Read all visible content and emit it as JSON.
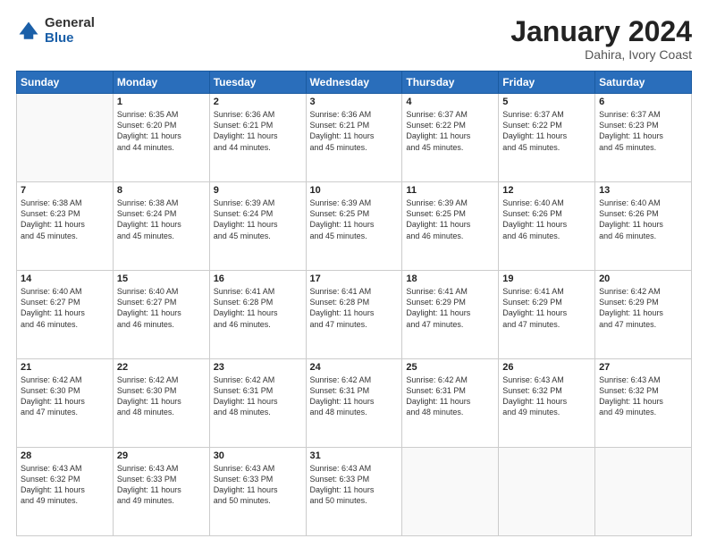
{
  "header": {
    "logo_general": "General",
    "logo_blue": "Blue",
    "month_title": "January 2024",
    "location": "Dahira, Ivory Coast"
  },
  "weekdays": [
    "Sunday",
    "Monday",
    "Tuesday",
    "Wednesday",
    "Thursday",
    "Friday",
    "Saturday"
  ],
  "weeks": [
    [
      {
        "day": "",
        "info": ""
      },
      {
        "day": "1",
        "info": "Sunrise: 6:35 AM\nSunset: 6:20 PM\nDaylight: 11 hours\nand 44 minutes."
      },
      {
        "day": "2",
        "info": "Sunrise: 6:36 AM\nSunset: 6:21 PM\nDaylight: 11 hours\nand 44 minutes."
      },
      {
        "day": "3",
        "info": "Sunrise: 6:36 AM\nSunset: 6:21 PM\nDaylight: 11 hours\nand 45 minutes."
      },
      {
        "day": "4",
        "info": "Sunrise: 6:37 AM\nSunset: 6:22 PM\nDaylight: 11 hours\nand 45 minutes."
      },
      {
        "day": "5",
        "info": "Sunrise: 6:37 AM\nSunset: 6:22 PM\nDaylight: 11 hours\nand 45 minutes."
      },
      {
        "day": "6",
        "info": "Sunrise: 6:37 AM\nSunset: 6:23 PM\nDaylight: 11 hours\nand 45 minutes."
      }
    ],
    [
      {
        "day": "7",
        "info": "Sunrise: 6:38 AM\nSunset: 6:23 PM\nDaylight: 11 hours\nand 45 minutes."
      },
      {
        "day": "8",
        "info": "Sunrise: 6:38 AM\nSunset: 6:24 PM\nDaylight: 11 hours\nand 45 minutes."
      },
      {
        "day": "9",
        "info": "Sunrise: 6:39 AM\nSunset: 6:24 PM\nDaylight: 11 hours\nand 45 minutes."
      },
      {
        "day": "10",
        "info": "Sunrise: 6:39 AM\nSunset: 6:25 PM\nDaylight: 11 hours\nand 45 minutes."
      },
      {
        "day": "11",
        "info": "Sunrise: 6:39 AM\nSunset: 6:25 PM\nDaylight: 11 hours\nand 46 minutes."
      },
      {
        "day": "12",
        "info": "Sunrise: 6:40 AM\nSunset: 6:26 PM\nDaylight: 11 hours\nand 46 minutes."
      },
      {
        "day": "13",
        "info": "Sunrise: 6:40 AM\nSunset: 6:26 PM\nDaylight: 11 hours\nand 46 minutes."
      }
    ],
    [
      {
        "day": "14",
        "info": "Sunrise: 6:40 AM\nSunset: 6:27 PM\nDaylight: 11 hours\nand 46 minutes."
      },
      {
        "day": "15",
        "info": "Sunrise: 6:40 AM\nSunset: 6:27 PM\nDaylight: 11 hours\nand 46 minutes."
      },
      {
        "day": "16",
        "info": "Sunrise: 6:41 AM\nSunset: 6:28 PM\nDaylight: 11 hours\nand 46 minutes."
      },
      {
        "day": "17",
        "info": "Sunrise: 6:41 AM\nSunset: 6:28 PM\nDaylight: 11 hours\nand 47 minutes."
      },
      {
        "day": "18",
        "info": "Sunrise: 6:41 AM\nSunset: 6:29 PM\nDaylight: 11 hours\nand 47 minutes."
      },
      {
        "day": "19",
        "info": "Sunrise: 6:41 AM\nSunset: 6:29 PM\nDaylight: 11 hours\nand 47 minutes."
      },
      {
        "day": "20",
        "info": "Sunrise: 6:42 AM\nSunset: 6:29 PM\nDaylight: 11 hours\nand 47 minutes."
      }
    ],
    [
      {
        "day": "21",
        "info": "Sunrise: 6:42 AM\nSunset: 6:30 PM\nDaylight: 11 hours\nand 47 minutes."
      },
      {
        "day": "22",
        "info": "Sunrise: 6:42 AM\nSunset: 6:30 PM\nDaylight: 11 hours\nand 48 minutes."
      },
      {
        "day": "23",
        "info": "Sunrise: 6:42 AM\nSunset: 6:31 PM\nDaylight: 11 hours\nand 48 minutes."
      },
      {
        "day": "24",
        "info": "Sunrise: 6:42 AM\nSunset: 6:31 PM\nDaylight: 11 hours\nand 48 minutes."
      },
      {
        "day": "25",
        "info": "Sunrise: 6:42 AM\nSunset: 6:31 PM\nDaylight: 11 hours\nand 48 minutes."
      },
      {
        "day": "26",
        "info": "Sunrise: 6:43 AM\nSunset: 6:32 PM\nDaylight: 11 hours\nand 49 minutes."
      },
      {
        "day": "27",
        "info": "Sunrise: 6:43 AM\nSunset: 6:32 PM\nDaylight: 11 hours\nand 49 minutes."
      }
    ],
    [
      {
        "day": "28",
        "info": "Sunrise: 6:43 AM\nSunset: 6:32 PM\nDaylight: 11 hours\nand 49 minutes."
      },
      {
        "day": "29",
        "info": "Sunrise: 6:43 AM\nSunset: 6:33 PM\nDaylight: 11 hours\nand 49 minutes."
      },
      {
        "day": "30",
        "info": "Sunrise: 6:43 AM\nSunset: 6:33 PM\nDaylight: 11 hours\nand 50 minutes."
      },
      {
        "day": "31",
        "info": "Sunrise: 6:43 AM\nSunset: 6:33 PM\nDaylight: 11 hours\nand 50 minutes."
      },
      {
        "day": "",
        "info": ""
      },
      {
        "day": "",
        "info": ""
      },
      {
        "day": "",
        "info": ""
      }
    ]
  ]
}
